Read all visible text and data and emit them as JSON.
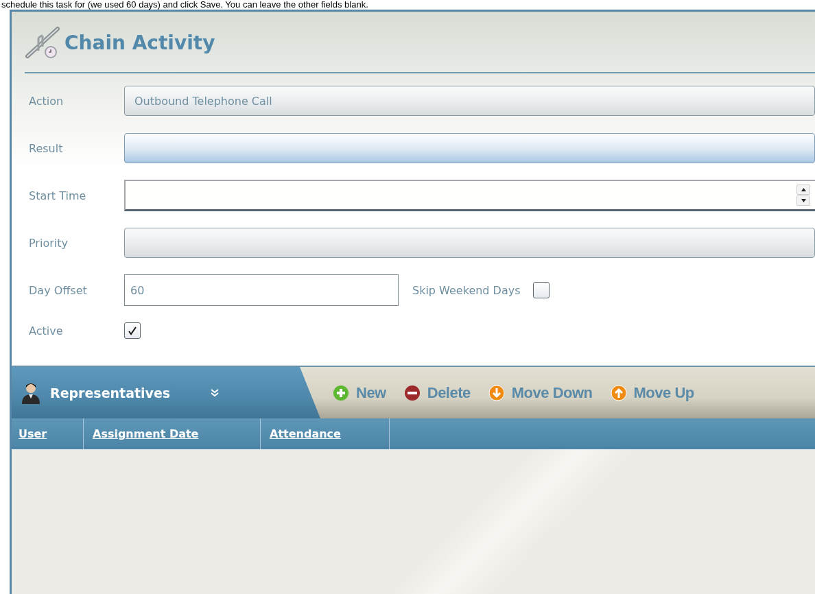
{
  "caption": "schedule this task for (we used 60 days) and click Save. You can leave the other fields blank.",
  "title": "Chain Activity",
  "fields": [
    {
      "label": "Action",
      "kind": "dropdown",
      "value": "Outbound Telephone Call",
      "highlighted": false
    },
    {
      "label": "Result",
      "kind": "dropdown",
      "highlighted": true
    },
    {
      "label": "Start Time",
      "kind": "spinner"
    },
    {
      "label": "Priority",
      "kind": "dropdown",
      "highlighted": false
    },
    {
      "label": "Day Offset",
      "kind": "text",
      "value": "60",
      "extra": {
        "label": "Skip Weekend Days",
        "checked": false
      }
    },
    {
      "label": "Active",
      "kind": "checkbox",
      "checked": true
    }
  ],
  "representatives": {
    "title": "Representatives",
    "actions": [
      {
        "label": "New",
        "kind": "add"
      },
      {
        "label": "Delete",
        "kind": "delete"
      },
      {
        "label": "Move Down",
        "kind": "down"
      },
      {
        "label": "Move Up",
        "kind": "up"
      }
    ],
    "columns": [
      "User",
      "Assignment Date",
      "Attendance"
    ]
  }
}
